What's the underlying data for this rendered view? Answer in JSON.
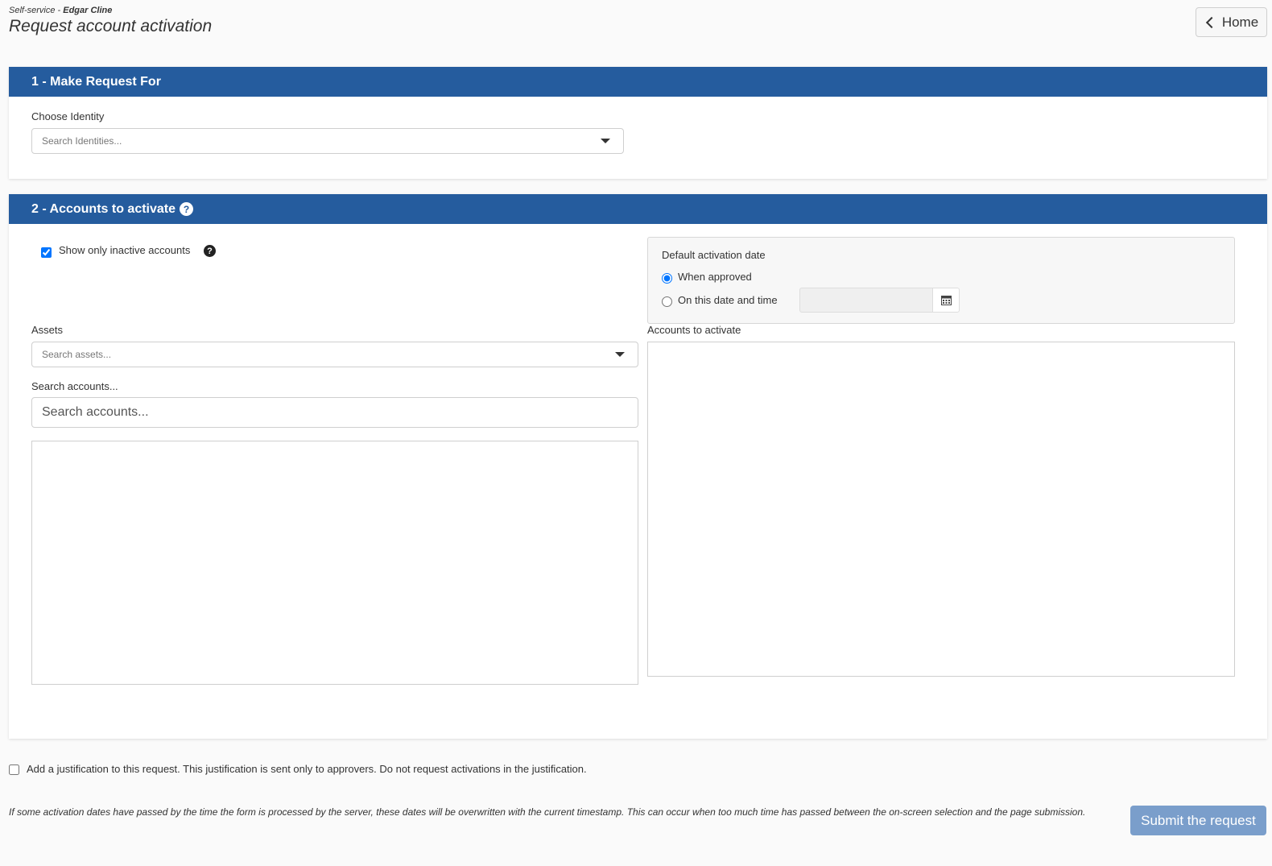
{
  "header": {
    "crumb_prefix": "Self-service -",
    "user_name": "Edgar Cline",
    "title": "Request account activation",
    "home_label": "Home"
  },
  "section1": {
    "title": "1 - Make Request For",
    "identity_label": "Choose Identity",
    "identity_placeholder": "Search Identities..."
  },
  "section2": {
    "title": "2 - Accounts to activate",
    "show_inactive_label": "Show only inactive accounts",
    "show_inactive_checked": true,
    "default_date_title": "Default activation date",
    "option_when_approved": "When approved",
    "option_on_date": "On this date and time",
    "assets_label": "Assets",
    "assets_placeholder": "Search assets...",
    "search_accounts_label": "Search accounts...",
    "search_accounts_placeholder": "Search accounts...",
    "accounts_to_activate_label": "Accounts to activate"
  },
  "footer": {
    "justification_label": "Add a justification to this request. This justification is sent only to approvers. Do not request activations in the justification.",
    "note": "If some activation dates have passed by the time the form is processed by the server, these dates will be overwritten with the current timestamp. This can occur when too much time has passed between the on-screen selection and the page submission.",
    "submit_label": "Submit the request"
  },
  "colors": {
    "panel_header": "#255c9e",
    "submit_button": "#7a9ecb"
  }
}
